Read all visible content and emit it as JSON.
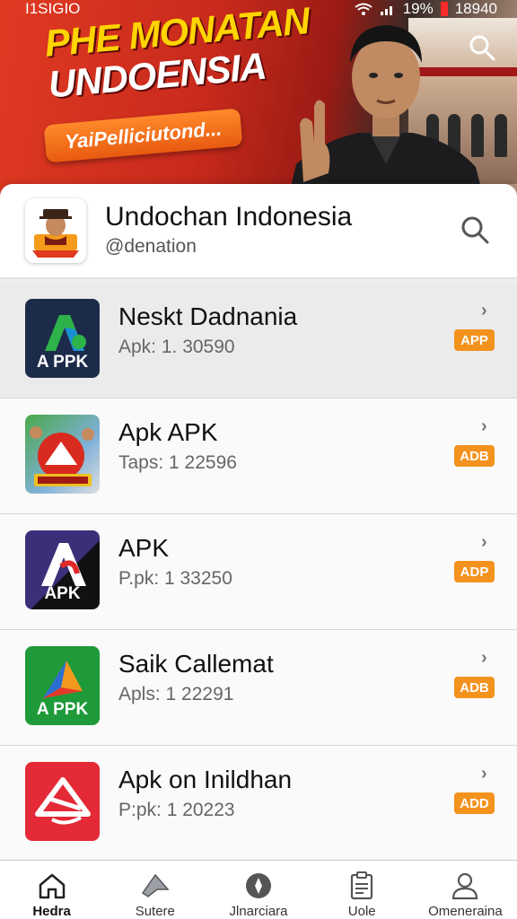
{
  "status_bar": {
    "left_text": "I1SIGIO",
    "battery": "19%",
    "time": "18940"
  },
  "banner": {
    "title_line1": "PHE MONATAN",
    "title_line2": "UNDOENSIA",
    "pill_text": "YaiPelliciutond...",
    "search_icon": "search-icon"
  },
  "profile": {
    "name": "Undochan Indonesia",
    "handle": "@denation",
    "search_icon": "search-icon"
  },
  "apps": [
    {
      "title": "Neskt Dadnania",
      "subtitle": "Apk: 1. 30590",
      "badge": "APP",
      "icon_label": "A PPK",
      "highlight": true
    },
    {
      "title": "Apk APK",
      "subtitle": "Taps: 1 22596",
      "badge": "ADB",
      "icon_label": "",
      "highlight": false
    },
    {
      "title": "APK",
      "subtitle": "P.pk: 1 33250",
      "badge": "ADP",
      "icon_label": "APK",
      "highlight": false
    },
    {
      "title": "Saik Callemat",
      "subtitle": "Apls: 1 22291",
      "badge": "ADB",
      "icon_label": "A PPK",
      "highlight": false
    },
    {
      "title": "Apk on Inildhan",
      "subtitle": "P:pk: 1 20223",
      "badge": "ADD",
      "icon_label": "",
      "highlight": false
    }
  ],
  "bottom_nav": [
    {
      "label": "Hedra",
      "icon": "home-icon",
      "active": true
    },
    {
      "label": "Sutere",
      "icon": "send-icon",
      "active": false
    },
    {
      "label": "Jlnarciara",
      "icon": "compass-icon",
      "active": false
    },
    {
      "label": "Uole",
      "icon": "clipboard-icon",
      "active": false
    },
    {
      "label": "Omeneraina",
      "icon": "profile-icon",
      "active": false
    }
  ],
  "colors": {
    "accent": "#f4921e",
    "banner_red": "#c82a1c",
    "title_yellow": "#ffd400"
  }
}
